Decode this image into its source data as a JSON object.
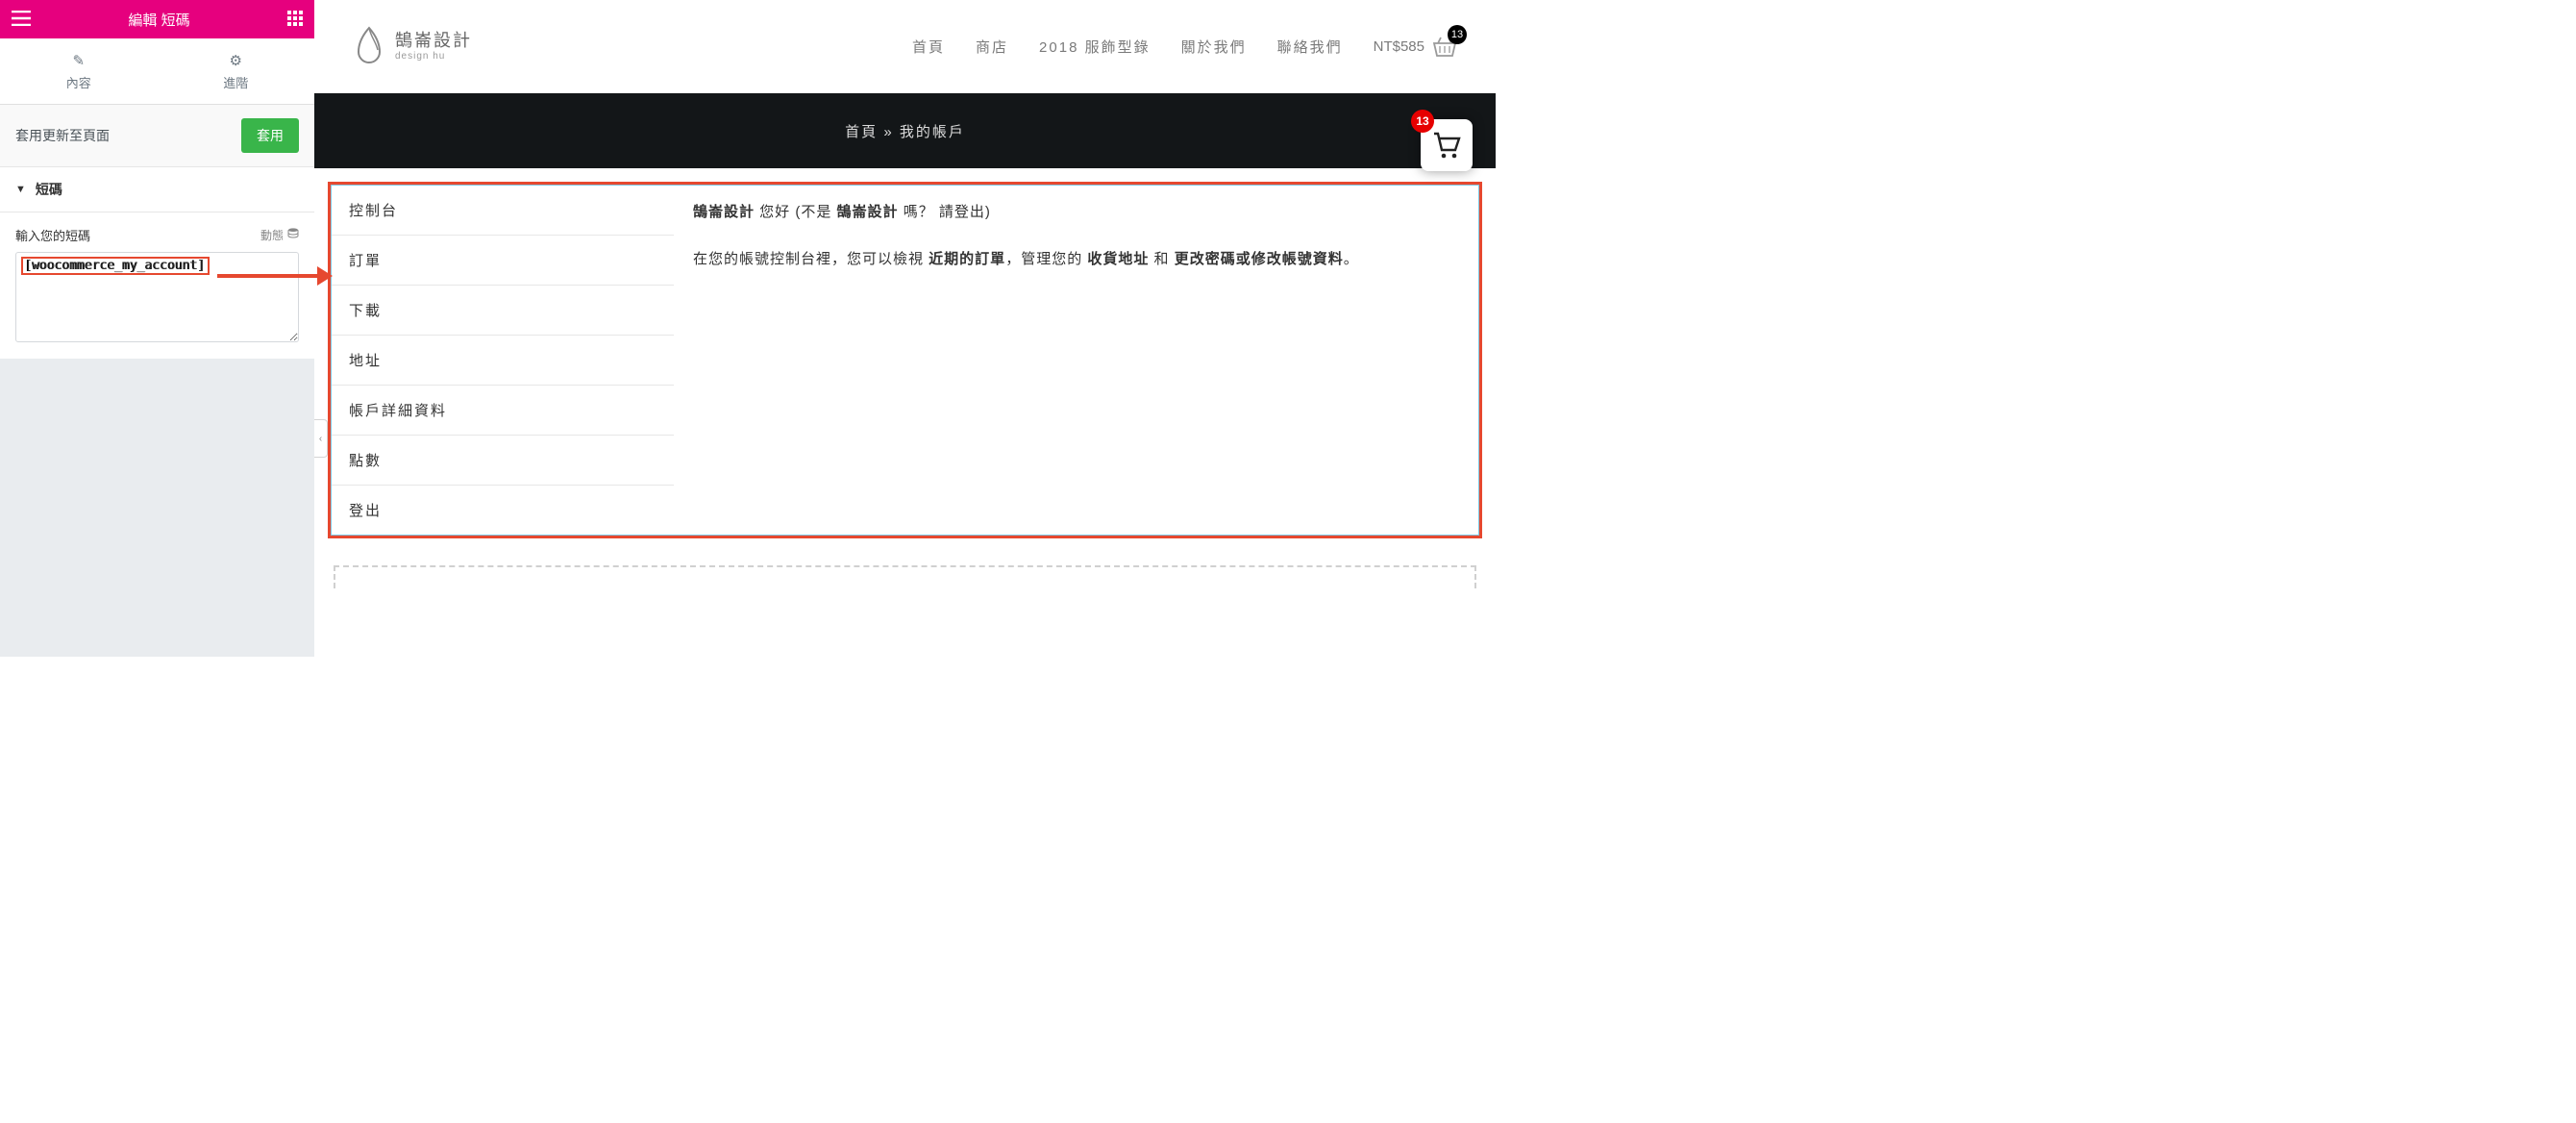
{
  "editor": {
    "title": "編輯 短碼",
    "tabs": {
      "content": "內容",
      "advanced": "進階"
    },
    "apply_row": {
      "text": "套用更新至頁面",
      "button": "套用"
    },
    "section_title": "短碼",
    "field_label": "輸入您的短碼",
    "dynamic_label": "動態",
    "shortcode_value": "[woocommerce_my_account]"
  },
  "site": {
    "logo": {
      "zh": "鵠崙設計",
      "en": "design hu"
    },
    "nav": [
      "首頁",
      "商店",
      "2018 服飾型錄",
      "關於我們",
      "聯絡我們"
    ],
    "cart": {
      "total": "NT$585",
      "count": "13"
    }
  },
  "hero": {
    "home": "首頁",
    "sep": " » ",
    "current": "我的帳戶"
  },
  "floating_cart_count": "13",
  "account": {
    "nav": [
      "控制台",
      "訂單",
      "下載",
      "地址",
      "帳戶詳細資料",
      "點數",
      "登出"
    ],
    "greeting": {
      "name1": "鵠崙設計",
      "hello": " 您好 (不是 ",
      "name2": "鵠崙設計",
      "q": " 嗎？ ",
      "logout": "請登出",
      "close": ")"
    },
    "body": {
      "p1a": "在您的帳號控制台裡，您可以檢視 ",
      "recent": "近期的訂單",
      "p1b": "，管理您的 ",
      "addr": "收貨地址",
      "and": " 和 ",
      "pw": "更改密碼或修改帳號資料",
      "end": "。"
    }
  }
}
